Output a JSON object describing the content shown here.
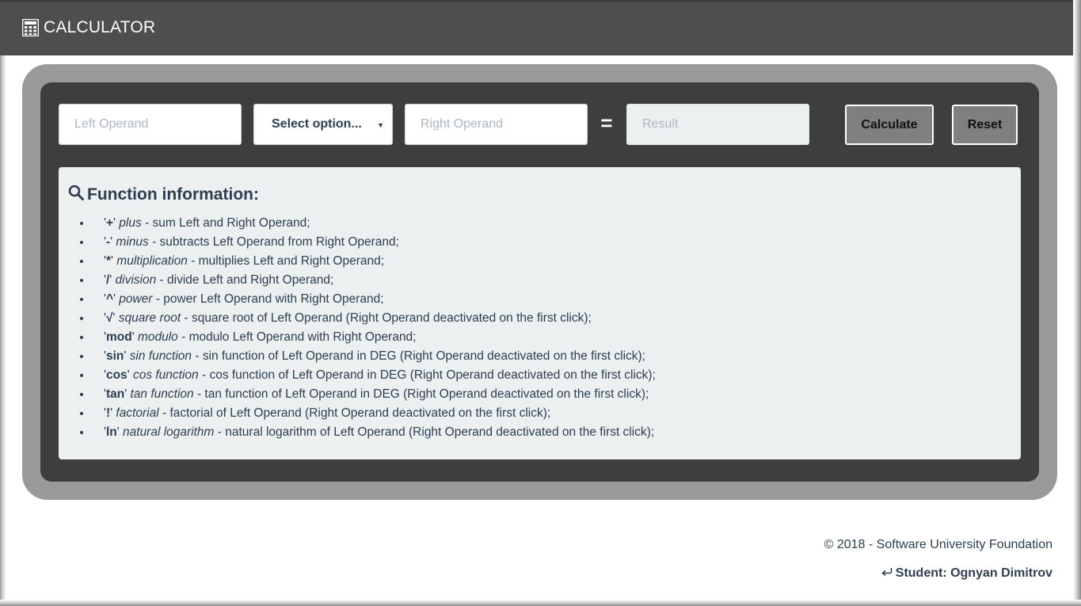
{
  "navbar": {
    "icon": "calculator-icon",
    "title": "CALCULATOR"
  },
  "form": {
    "left_placeholder": "Left Operand",
    "select_label": "Select option...",
    "right_placeholder": "Right Operand",
    "equals": "=",
    "result_placeholder": "Result",
    "calculate_label": "Calculate",
    "reset_label": "Reset"
  },
  "info": {
    "icon": "search-icon",
    "title": "Function information:",
    "items": [
      {
        "symbol": "+",
        "name": "plus",
        "desc": " - sum Left and Right Operand;",
        "quoted": true
      },
      {
        "symbol": "-",
        "name": "minus",
        "desc": " - subtracts Left Operand from Right Operand;",
        "quoted": true
      },
      {
        "symbol": "*",
        "name": "multiplication",
        "desc": " - multiplies Left and Right Operand;",
        "quoted": true
      },
      {
        "symbol": "/",
        "name": "division",
        "desc": " - divide Left and Right Operand;",
        "quoted": true
      },
      {
        "symbol": "^",
        "name": "power",
        "desc": " - power Left Operand with Right Operand;",
        "quoted": true
      },
      {
        "symbol": "√",
        "name": "square root",
        "desc": " - square root of Left Operand (Right Operand deactivated on the first click);",
        "quoted": true
      },
      {
        "symbol": "mod",
        "name": "modulo",
        "desc": " - modulo Left Operand with Right Operand;",
        "quoted": true
      },
      {
        "symbol": "sin",
        "name": "sin function",
        "desc": " - sin function of Left Operand in DEG (Right Operand deactivated on the first click);",
        "quoted": true
      },
      {
        "symbol": "cos",
        "name": "cos function",
        "desc": " - cos function of Left Operand in DEG (Right Operand deactivated on the first click);",
        "quoted": true
      },
      {
        "symbol": "tan",
        "name": "tan function",
        "desc": " - tan function of Left Operand in DEG (Right Operand deactivated on the first click);",
        "quoted": true
      },
      {
        "symbol": "!",
        "name": "factorial",
        "desc": " - factorial of Left Operand (Right Operand deactivated on the first click);",
        "quoted": true
      },
      {
        "symbol": "ln",
        "name": "natural logarithm",
        "desc": " - natural logarithm of Left Operand (Right Operand deactivated on the first click);",
        "quoted": true
      }
    ]
  },
  "footer": {
    "copyright": "© 2018 - Software University Foundation",
    "student_icon": "share-arrow-icon",
    "student": "Student: Ognyan Dimitrov"
  }
}
